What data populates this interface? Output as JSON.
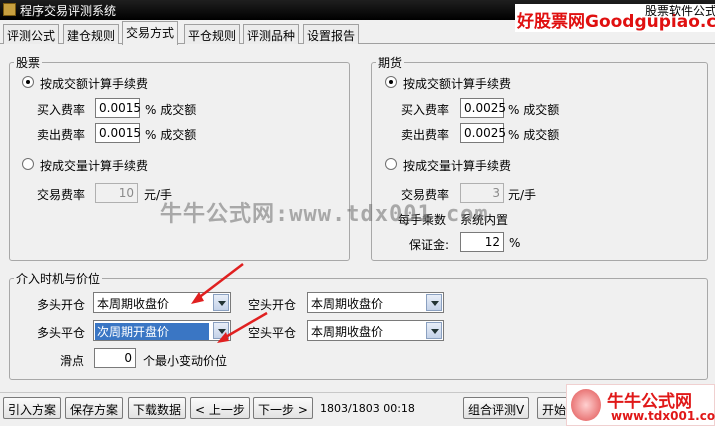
{
  "window": {
    "title": "程序交易评测系统"
  },
  "tabs": [
    "评测公式",
    "建仓规则",
    "交易方式",
    "平仓规则",
    "评测品种",
    "设置报告"
  ],
  "watermark_top": {
    "brand": "好股票网Goodgupiao.com",
    "small": "股票软件公式"
  },
  "stock": {
    "legend": "股票",
    "opt_amount": "按成交额计算手续费",
    "buy_label": "买入费率",
    "buy_value": "0.0015",
    "buy_unit": "% 成交额",
    "sell_label": "卖出费率",
    "sell_value": "0.0015",
    "sell_unit": "% 成交额",
    "opt_volume": "按成交量计算手续费",
    "fee_label": "交易费率",
    "fee_value": "10",
    "fee_unit": "元/手"
  },
  "futures": {
    "legend": "期货",
    "opt_amount": "按成交额计算手续费",
    "buy_label": "买入费率",
    "buy_value": "0.0025",
    "buy_unit": "% 成交额",
    "sell_label": "卖出费率",
    "sell_value": "0.0025",
    "sell_unit": "% 成交额",
    "opt_volume": "按成交量计算手续费",
    "fee_label": "交易费率",
    "fee_value": "3",
    "fee_unit": "元/手",
    "lot_label": "每手乘数",
    "lot_note": "系统内置",
    "margin_label": "保证金:",
    "margin_value": "12",
    "margin_unit": "%"
  },
  "timing": {
    "legend": "介入时机与价位",
    "long_open_label": "多头开仓",
    "long_open_value": "本周期收盘价",
    "long_close_label": "多头平仓",
    "long_close_value": "次周期开盘价",
    "short_open_label": "空头开仓",
    "short_open_value": "本周期收盘价",
    "short_close_label": "空头平仓",
    "short_close_value": "本周期收盘价",
    "slip_label": "滑点",
    "slip_value": "0",
    "slip_unit": "个最小变动价位"
  },
  "watermark_center": "牛牛公式网:www.tdx001.com",
  "bottom": {
    "import": "引入方案",
    "save": "保存方案",
    "download": "下载数据",
    "prev": "< 上一步",
    "next": "下一步 >",
    "progress": "1803/1803 00:18",
    "combo": "组合评测V",
    "start": "开始"
  },
  "logo_br": {
    "name": "牛牛公式网",
    "url": "www.tdx001.com"
  },
  "colors": {
    "titlebar": "#000000",
    "annotation_arrow": "#e02020",
    "logo_red": "#e01818"
  }
}
